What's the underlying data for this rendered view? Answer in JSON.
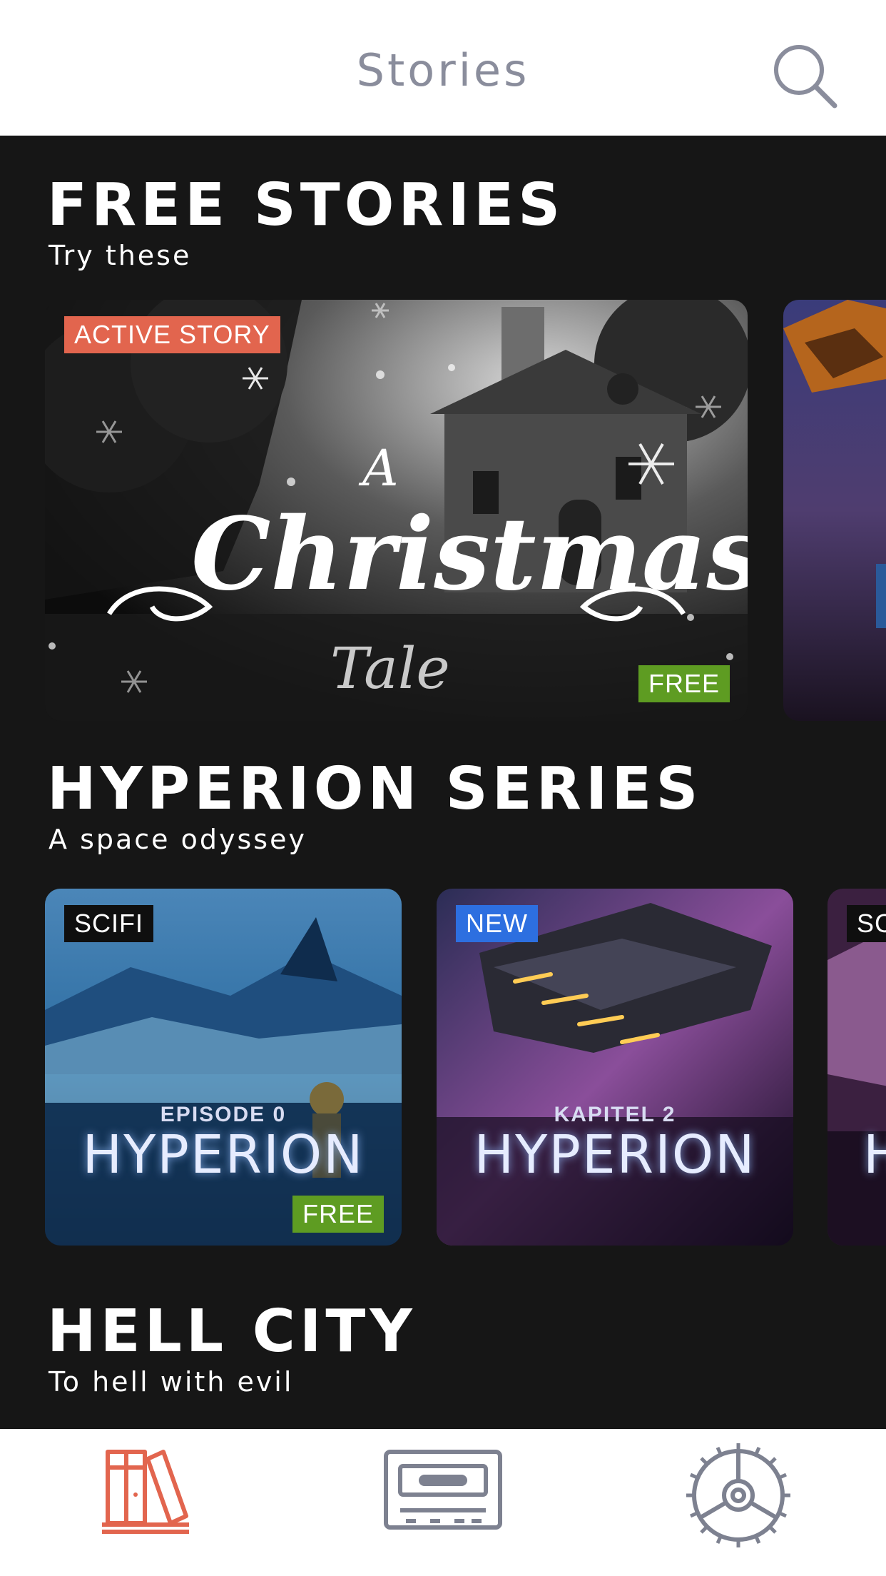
{
  "header": {
    "title": "Stories",
    "search_icon": "search-icon"
  },
  "sections": [
    {
      "title": "FREE STORIES",
      "subtitle": "Try these",
      "cards": [
        {
          "badge_top": "ACTIVE STORY",
          "badge_bottom": "FREE",
          "art_title_line1": "A",
          "art_title_line2": "Christmas",
          "art_title_line3": "Tale"
        }
      ]
    },
    {
      "title": "HYPERION SERIES",
      "subtitle": "A space odyssey",
      "cards": [
        {
          "badge_top": "SCIFI",
          "label": "EPISODE 0",
          "title": "HYPERION",
          "badge_bottom": "FREE"
        },
        {
          "badge_top": "NEW",
          "label": "KAPITEL 2",
          "title": "HYPERION"
        },
        {
          "badge_top": "SC",
          "title": "H"
        }
      ]
    },
    {
      "title": "HELL CITY",
      "subtitle": "To hell with evil"
    }
  ],
  "tabbar": {
    "items": [
      {
        "icon": "library-books-icon",
        "active": true
      },
      {
        "icon": "cassette-tape-icon",
        "active": false
      },
      {
        "icon": "settings-gear-icon",
        "active": false
      }
    ]
  },
  "colors": {
    "accent": "#e2654e",
    "free_badge": "#5e9c22",
    "new_badge": "#2d6fe0",
    "inactive_icon": "#7d8190",
    "background": "#161616"
  }
}
